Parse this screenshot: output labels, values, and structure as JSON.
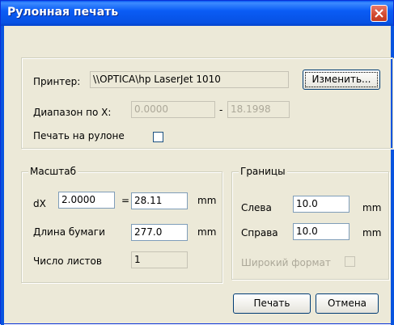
{
  "window": {
    "title": "Рулонная печать",
    "close_icon": "close-icon"
  },
  "printer": {
    "label": "Принтер:",
    "name": "\\\\OPTICA\\hp LaserJet 1010",
    "change_button": "Изменить...",
    "range_label": "Диапазон по X:",
    "range_from": "0.0000",
    "range_sep": "-",
    "range_to": "18.1998",
    "roll_label": "Печать на рулоне",
    "roll_checked": false
  },
  "scale": {
    "legend": "Масштаб",
    "dx_label": "dX",
    "dx_value": "2.0000",
    "equals": "=",
    "mm_value": "28.11",
    "mm_unit": "mm",
    "paper_length_label": "Длина бумаги",
    "paper_length_value": "277.0",
    "paper_length_unit": "mm",
    "sheet_count_label": "Число листов",
    "sheet_count_value": "1"
  },
  "borders": {
    "legend": "Границы",
    "left_label": "Слева",
    "left_value": "10.0",
    "left_unit": "mm",
    "right_label": "Справа",
    "right_value": "10.0",
    "right_unit": "mm",
    "wide_label": "Широкий формат",
    "wide_checked": false
  },
  "actions": {
    "print": "Печать",
    "cancel": "Отмена"
  }
}
